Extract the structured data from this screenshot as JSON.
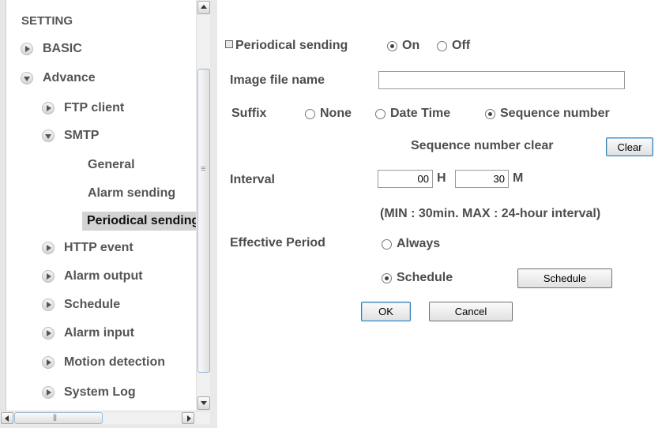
{
  "sidebar": {
    "title": "SETTING",
    "items": [
      {
        "label": "BASIC",
        "expanded": false
      },
      {
        "label": "Advance",
        "expanded": true
      },
      {
        "label": "FTP client",
        "expanded": false
      },
      {
        "label": "SMTP",
        "expanded": true
      },
      {
        "label": "HTTP event",
        "expanded": false
      },
      {
        "label": "Alarm output",
        "expanded": false
      },
      {
        "label": "Schedule",
        "expanded": false
      },
      {
        "label": "Alarm input",
        "expanded": false
      },
      {
        "label": "Motion detection",
        "expanded": false
      },
      {
        "label": "System Log",
        "expanded": false
      }
    ],
    "smtp_subitems": [
      "General",
      "Alarm sending",
      "Periodical sending"
    ],
    "active_subitem": "Periodical sending"
  },
  "form": {
    "section_title": "Periodical sending",
    "mode_options": [
      "On",
      "Off"
    ],
    "mode_selected": "On",
    "image_file_name_label": "Image file name",
    "image_file_name_value": "",
    "suffix_label": "Suffix",
    "suffix_options": [
      "None",
      "Date Time",
      "Sequence number"
    ],
    "suffix_selected": "Sequence number",
    "seq_clear_label": "Sequence number clear",
    "clear_button": "Clear",
    "interval_label": "Interval",
    "interval_hours": "00",
    "hours_unit": "H",
    "interval_minutes": "30",
    "minutes_unit": "M",
    "interval_note": "(MIN : 30min. MAX : 24-hour interval)",
    "effective_period_label": "Effective Period",
    "period_options": [
      "Always",
      "Schedule"
    ],
    "period_selected": "Schedule",
    "schedule_button": "Schedule",
    "ok_button": "OK",
    "cancel_button": "Cancel"
  },
  "icons": {
    "collapsed_arrow": "chevron-right-circle-icon",
    "expanded_arrow": "chevron-down-circle-icon",
    "section_marker": "square-bullet-icon"
  },
  "colors": {
    "active_item_bg": "#d3d3d3",
    "text": "#4d4d4d",
    "primary_button_border": "#3c7fb1"
  }
}
